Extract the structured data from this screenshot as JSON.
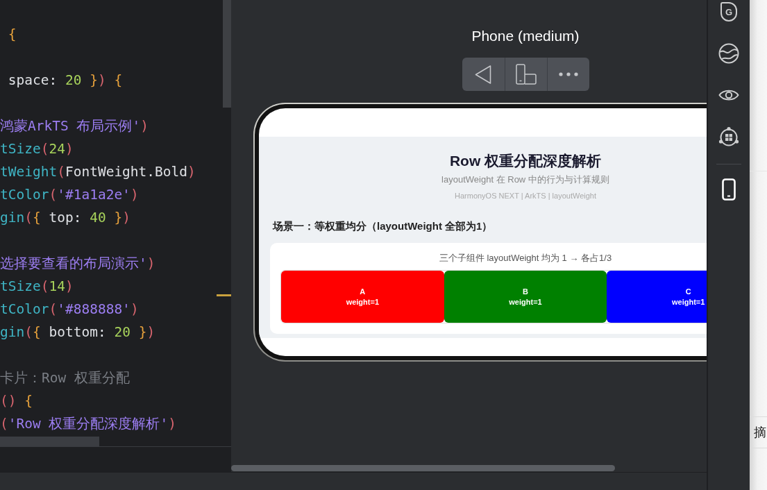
{
  "editor": {
    "blocks": [
      {
        "lines": [
          {
            "tokens": [
              {
                "kind": "brace",
                "text": " {"
              }
            ]
          }
        ]
      },
      {
        "lines": [
          {
            "tokens": [
              {
                "kind": "plain",
                "text": " space: "
              },
              {
                "kind": "number",
                "text": "20"
              },
              {
                "kind": "brace",
                "text": " }"
              },
              {
                "kind": "paren",
                "text": ")"
              },
              {
                "kind": "brace",
                "text": " {"
              }
            ]
          }
        ]
      },
      {
        "lines": [
          {
            "tokens": [
              {
                "kind": "string",
                "text": "鸿蒙ArkTS 布局示例'"
              },
              {
                "kind": "paren",
                "text": ")"
              }
            ]
          },
          {
            "tokens": [
              {
                "kind": "method",
                "text": "tSize"
              },
              {
                "kind": "paren",
                "text": "("
              },
              {
                "kind": "number",
                "text": "24"
              },
              {
                "kind": "paren",
                "text": ")"
              }
            ]
          },
          {
            "tokens": [
              {
                "kind": "method",
                "text": "tWeight"
              },
              {
                "kind": "paren",
                "text": "("
              },
              {
                "kind": "plain",
                "text": "FontWeight.Bold"
              },
              {
                "kind": "paren",
                "text": ")"
              }
            ]
          },
          {
            "tokens": [
              {
                "kind": "method",
                "text": "tColor"
              },
              {
                "kind": "paren",
                "text": "("
              },
              {
                "kind": "string",
                "text": "'#1a1a2e'"
              },
              {
                "kind": "paren",
                "text": ")"
              }
            ]
          },
          {
            "tokens": [
              {
                "kind": "method",
                "text": "gin"
              },
              {
                "kind": "paren",
                "text": "("
              },
              {
                "kind": "brace",
                "text": "{"
              },
              {
                "kind": "plain",
                "text": " top: "
              },
              {
                "kind": "number",
                "text": "40"
              },
              {
                "kind": "brace",
                "text": " }"
              },
              {
                "kind": "paren",
                "text": ")"
              }
            ]
          }
        ]
      },
      {
        "lines": [
          {
            "tokens": [
              {
                "kind": "string",
                "text": "选择要查看的布局演示'"
              },
              {
                "kind": "paren",
                "text": ")"
              }
            ]
          },
          {
            "tokens": [
              {
                "kind": "method",
                "text": "tSize"
              },
              {
                "kind": "paren",
                "text": "("
              },
              {
                "kind": "number",
                "text": "14"
              },
              {
                "kind": "paren",
                "text": ")"
              }
            ]
          },
          {
            "tokens": [
              {
                "kind": "method",
                "text": "tColor"
              },
              {
                "kind": "paren",
                "text": "("
              },
              {
                "kind": "string",
                "text": "'#888888'"
              },
              {
                "kind": "paren",
                "text": ")"
              }
            ]
          },
          {
            "tokens": [
              {
                "kind": "method",
                "text": "gin"
              },
              {
                "kind": "paren",
                "text": "("
              },
              {
                "kind": "brace",
                "text": "{"
              },
              {
                "kind": "plain",
                "text": " bottom: "
              },
              {
                "kind": "number",
                "text": "20"
              },
              {
                "kind": "brace",
                "text": " }"
              },
              {
                "kind": "paren",
                "text": ")"
              }
            ]
          }
        ]
      },
      {
        "lines": [
          {
            "tokens": [
              {
                "kind": "comment",
                "text": "卡片：Row 权重分配"
              }
            ]
          },
          {
            "tokens": [
              {
                "kind": "paren",
                "text": "()"
              },
              {
                "kind": "brace",
                "text": " {"
              }
            ]
          },
          {
            "tokens": [
              {
                "kind": "paren",
                "text": "("
              },
              {
                "kind": "string",
                "text": "'Row 权重分配深度解析'"
              },
              {
                "kind": "paren",
                "text": ")"
              }
            ]
          }
        ]
      }
    ]
  },
  "preview": {
    "device_name": "Phone (medium)",
    "screen": {
      "title": "Row 权重分配深度解析",
      "subtitle": "layoutWeight 在 Row 中的行为与计算规则",
      "tags": "HarmonyOS NEXT | ArkTS | layoutWeight",
      "section_title": "场景一：等权重均分（layoutWeight 全部为1）",
      "card": {
        "caption": "三个子组件 layoutWeight 均为 1 → 各占1/3",
        "blocks": [
          {
            "label": "A",
            "weight": "weight=1",
            "color": "#ff0000"
          },
          {
            "label": "B",
            "weight": "weight=1",
            "color": "#008000"
          },
          {
            "label": "C",
            "weight": "weight=1",
            "color": "#0000ff"
          }
        ]
      }
    }
  },
  "sidebar": {
    "groups": [
      {
        "items": [
          {
            "kind": "badge",
            "label": "G",
            "selected": false
          },
          {
            "kind": "globe",
            "selected": false
          },
          {
            "kind": "eye",
            "selected": false
          },
          {
            "kind": "cluster",
            "selected": false
          }
        ]
      },
      {
        "items": [
          {
            "kind": "phone",
            "selected": true
          }
        ]
      }
    ]
  },
  "side_panel": {
    "text": "摘"
  }
}
